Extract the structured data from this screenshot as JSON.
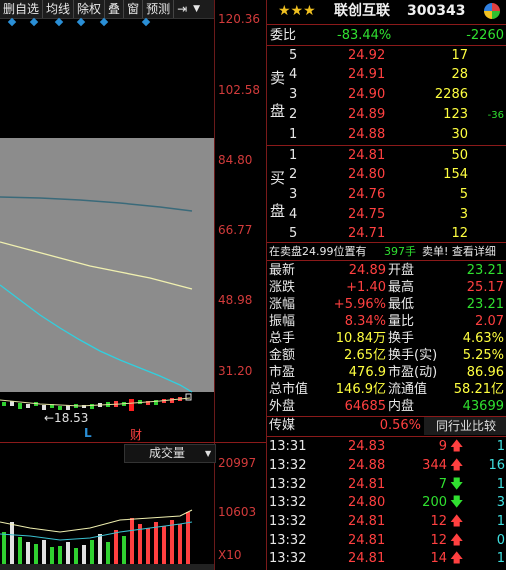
{
  "toolbar": {
    "items": [
      "删自选",
      "均线",
      "除权",
      "叠",
      "窗",
      "预测"
    ],
    "nav_icon": "⇥",
    "dropdown_icon": "▼"
  },
  "chart": {
    "price_labels": [
      "120.36",
      "102.58",
      "84.80",
      "66.77",
      "48.98",
      "31.20"
    ],
    "low_marker": "←18.53",
    "marker_L": "L",
    "marker_cai": "财",
    "volume_tab": "成交量",
    "volume_labels": [
      "20997",
      "10603",
      "X10"
    ]
  },
  "quote": {
    "stars": "★★★",
    "name": "联创互联",
    "code": "300343",
    "weibi_label": "委比",
    "weibi_value": "-83.44%",
    "weicha_value": "-2260",
    "sell_label_1": "卖",
    "sell_label_2": "盘",
    "buy_label_1": "买",
    "buy_label_2": "盘",
    "sell": [
      {
        "lvl": "5",
        "price": "24.92",
        "vol": "17",
        "chg": ""
      },
      {
        "lvl": "4",
        "price": "24.91",
        "vol": "28",
        "chg": ""
      },
      {
        "lvl": "3",
        "price": "24.90",
        "vol": "2286",
        "chg": ""
      },
      {
        "lvl": "2",
        "price": "24.89",
        "vol": "123",
        "chg": "-36"
      },
      {
        "lvl": "1",
        "price": "24.88",
        "vol": "30",
        "chg": ""
      }
    ],
    "buy": [
      {
        "lvl": "1",
        "price": "24.81",
        "vol": "50"
      },
      {
        "lvl": "2",
        "price": "24.80",
        "vol": "154"
      },
      {
        "lvl": "3",
        "price": "24.76",
        "vol": "5"
      },
      {
        "lvl": "4",
        "price": "24.75",
        "vol": "3"
      },
      {
        "lvl": "5",
        "price": "24.71",
        "vol": "12"
      }
    ],
    "notice_text": "在卖盘24.99位置有",
    "notice_vol": "397手",
    "notice_action": "卖单! 查看详细",
    "stats_left": [
      {
        "label": "最新",
        "value": "24.89",
        "color": "red"
      },
      {
        "label": "涨跌",
        "value": "+1.40",
        "color": "red"
      },
      {
        "label": "涨幅",
        "value": "+5.96%",
        "color": "red"
      },
      {
        "label": "振幅",
        "value": "8.34%",
        "color": "red"
      },
      {
        "label": "总手",
        "value": "10.84万",
        "color": "yel"
      },
      {
        "label": "金额",
        "value": "2.65亿",
        "color": "yel"
      },
      {
        "label": "市盈",
        "value": "476.9",
        "color": "yel"
      },
      {
        "label": "总市值",
        "value": "146.9亿",
        "color": "yel"
      },
      {
        "label": "外盘",
        "value": "64685",
        "color": "red"
      }
    ],
    "stats_right": [
      {
        "label": "开盘",
        "value": "23.21",
        "color": "grn"
      },
      {
        "label": "最高",
        "value": "25.17",
        "color": "red"
      },
      {
        "label": "最低",
        "value": "23.21",
        "color": "grn"
      },
      {
        "label": "量比",
        "value": "2.07",
        "color": "red"
      },
      {
        "label": "换手",
        "value": "4.63%",
        "color": "yel"
      },
      {
        "label": "换手(实)",
        "value": "5.25%",
        "color": "yel"
      },
      {
        "label": "市盈(动)",
        "value": "86.96",
        "color": "yel"
      },
      {
        "label": "流通值",
        "value": "58.21亿",
        "color": "yel"
      },
      {
        "label": "内盘",
        "value": "43699",
        "color": "grn"
      }
    ],
    "sector_name": "传媒",
    "sector_pct": "0.56%",
    "sector_tab": "同行业比较",
    "ticks": [
      {
        "time": "13:31",
        "price": "24.83",
        "vol": "9",
        "dir": "up",
        "cnt": "1"
      },
      {
        "time": "13:32",
        "price": "24.88",
        "vol": "344",
        "dir": "up",
        "cnt": "16"
      },
      {
        "time": "13:32",
        "price": "24.81",
        "vol": "7",
        "dir": "down",
        "cnt": "1"
      },
      {
        "time": "13:32",
        "price": "24.80",
        "vol": "200",
        "dir": "down",
        "cnt": "3"
      },
      {
        "time": "13:32",
        "price": "24.81",
        "vol": "12",
        "dir": "up",
        "cnt": "1"
      },
      {
        "time": "13:32",
        "price": "24.81",
        "vol": "12",
        "dir": "up",
        "cnt": "0"
      },
      {
        "time": "13:32",
        "price": "24.81",
        "vol": "14",
        "dir": "up",
        "cnt": "1"
      }
    ]
  },
  "colors": {
    "up": "#ff4040",
    "down": "#30e030",
    "accent": "#2a8fd6"
  }
}
